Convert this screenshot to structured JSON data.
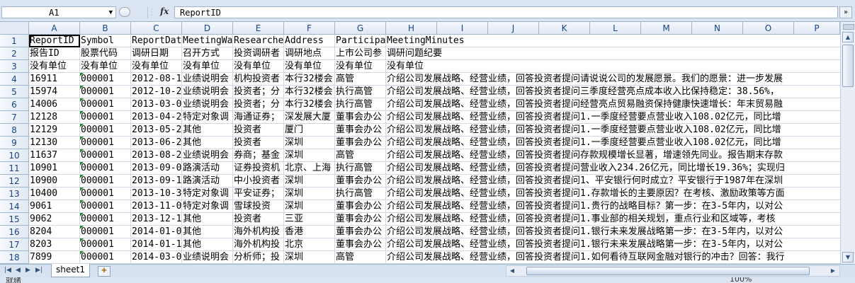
{
  "formula_bar": {
    "name_box": "A1",
    "fx_label": "fx",
    "content": "ReportID"
  },
  "columns": [
    "A",
    "B",
    "C",
    "D",
    "E",
    "F",
    "G",
    "H",
    "I",
    "J",
    "K",
    "L",
    "M",
    "N",
    "O",
    "P"
  ],
  "rows": [
    {
      "num": "1",
      "cells": [
        "ReportID",
        "Symbol",
        "ReportDat",
        "MeetingWa",
        "Researche",
        "Address",
        "Participa",
        "MeetingMinutes"
      ]
    },
    {
      "num": "2",
      "cells": [
        "报告ID",
        "股票代码",
        "调研日期",
        "召开方式",
        "投资调研者",
        "调研地点",
        "上市公司参",
        "调研问题纪要"
      ]
    },
    {
      "num": "3",
      "cells": [
        "没有单位",
        "没有单位",
        "没有单位",
        "没有单位",
        "没有单位",
        "没有单位",
        "没有单位",
        "没有单位"
      ]
    },
    {
      "num": "4",
      "cells": [
        "16911",
        "000001",
        "2012-08-1",
        "业绩说明会",
        "机构投资者",
        "本行32楼会",
        "高管",
        "介绍公司发展战略、经营业绩，回答投资者提问请说说公司的发展愿景。我们的愿景：进一步发展"
      ]
    },
    {
      "num": "5",
      "cells": [
        "15974",
        "000001",
        "2012-10-2",
        "业绩说明会",
        "投资者；分",
        "本行32楼会",
        "执行高管",
        "介绍公司发展战略、经营业绩，回答投资者提问三季度经营亮点成本收入比保持稳定：38.56%，"
      ]
    },
    {
      "num": "6",
      "cells": [
        "14006",
        "000001",
        "2013-03-0",
        "业绩说明会",
        "投资者；分",
        "本行32楼会",
        "执行高管",
        "介绍公司发展战略、经营业绩，回答投资者提问经营亮点贸易融资保持健康快速增长：年末贸易融"
      ]
    },
    {
      "num": "7",
      "cells": [
        "12128",
        "000001",
        "2013-04-2",
        "特定对象调",
        "海通证券；",
        "深发展大厦",
        "董事会办公",
        "介绍公司发展战略、经营业绩，回答投资者提问1.一季度经营要点营业收入108.02亿元，同比增"
      ]
    },
    {
      "num": "8",
      "cells": [
        "12129",
        "000001",
        "2013-05-2",
        "其他",
        "投资者",
        "厦门",
        "董事会办公",
        "介绍公司发展战略、经营业绩，回答投资者提问1.一季度经营要点营业收入108.02亿元，同比增"
      ]
    },
    {
      "num": "9",
      "cells": [
        "12130",
        "000001",
        "2013-06-2",
        "其他",
        "投资者",
        "深圳",
        "董事会办公",
        "介绍公司发展战略、经营业绩，回答投资者提问1.一季度经营要点营业收入108.02亿元，同比增"
      ]
    },
    {
      "num": "10",
      "cells": [
        "11637",
        "000001",
        "2013-08-2",
        "业绩说明会",
        "券商；基金",
        "深圳",
        "高管",
        "介绍公司发展战略、经营业绩，回答投资者提问存款规模增长显著，增速领先同业。报告期末存款"
      ]
    },
    {
      "num": "11",
      "cells": [
        "10901",
        "000001",
        "2013-09-0",
        "路演活动",
        "证券投资机",
        "北京、上海",
        "执行高管",
        "介绍公司发展战略、经营业绩，回答投资者提问营业收入234.26亿元，同比增长19.36%；实现归"
      ]
    },
    {
      "num": "12",
      "cells": [
        "10900",
        "000001",
        "2013-09-1",
        "路演活动",
        "中小投资者",
        "深圳",
        "董事会办公",
        "介绍公司发展战略、经营业绩，回答投资者提问1、平安银行何时成立？平安银行于1987年在深圳"
      ]
    },
    {
      "num": "13",
      "cells": [
        "10400",
        "000001",
        "2013-10-3",
        "特定对象调",
        "平安证券；",
        "深圳",
        "执行高管",
        "介绍公司发展战略、经营业绩，回答投资者提问1.存款增长的主要原因？在考核、激励政策等方面"
      ]
    },
    {
      "num": "14",
      "cells": [
        "9061",
        "000001",
        "2013-11-0",
        "特定对象调",
        "雪球投资",
        "深圳",
        "董事会办公",
        "介绍公司发展战略、经营业绩，回答投资者提问1.贵行的战略目标？第一步：在3-5年内，以对公"
      ]
    },
    {
      "num": "15",
      "cells": [
        "9062",
        "000001",
        "2013-12-1",
        "其他",
        "投资者",
        "三亚",
        "董事会办公",
        "介绍公司发展战略、经营业绩，回答投资者提问1.事业部的相关规划，重点行业和区域等，考核"
      ]
    },
    {
      "num": "16",
      "cells": [
        "8204",
        "000001",
        "2014-01-0",
        "其他",
        "海外机构投",
        "香港",
        "董事会办公",
        "介绍公司发展战略、经营业绩，回答投资者提问1.银行未来发展战略第一步：在3-5年内，以对公"
      ]
    },
    {
      "num": "17",
      "cells": [
        "8203",
        "000001",
        "2014-01-1",
        "其他",
        "海外机构投",
        "北京",
        "董事会办公",
        "介绍公司发展战略、经营业绩，回答投资者提问1.银行未来发展战略第一步：在3-5年内，以对公"
      ]
    },
    {
      "num": "18",
      "cells": [
        "7899",
        "000001",
        "2014-03-0",
        "业绩说明会",
        "分析师；投",
        "深圳",
        "高管",
        "介绍公司发展战略、经营业绩，回答投资者提问1.如何看待互联网金融对银行的冲击？回答：我行"
      ]
    }
  ],
  "sheet_tabs": [
    "sheet1"
  ],
  "status": {
    "left": "就绪",
    "zoom": "100%"
  },
  "colors": {
    "header_blue": "#15428b",
    "number_marker": "#1e8a2e",
    "grid_line": "#d0d7e5"
  }
}
